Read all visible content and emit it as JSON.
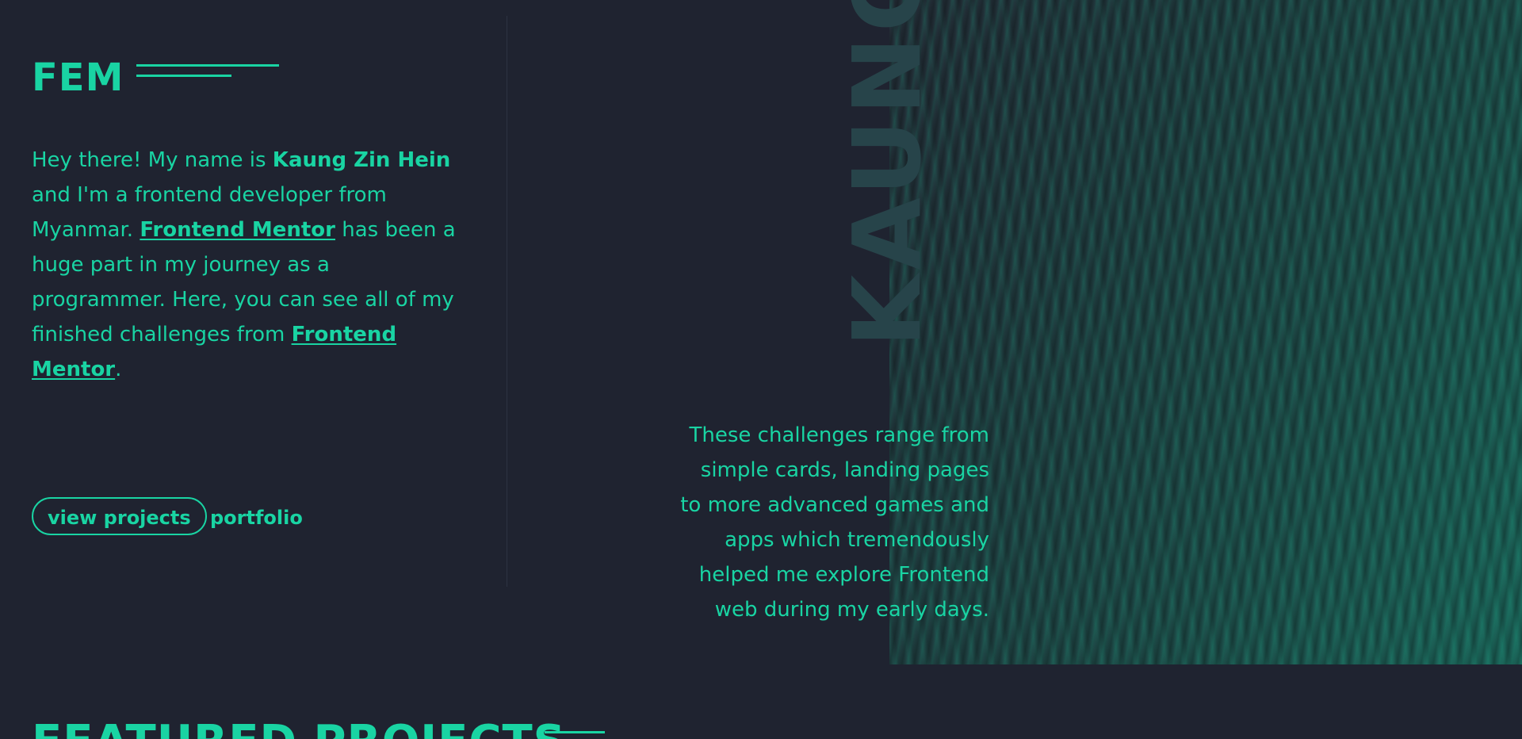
{
  "header": {
    "logo": "FEM"
  },
  "intro": {
    "part1": "Hey there! My name is ",
    "name": "Kaung Zin Hein",
    "part2": " and I'm a frontend developer from Myanmar. ",
    "link1": "Frontend Mentor",
    "part3": " has been a huge part in my journey as a programmer. Here, you can see all of my finished challenges from ",
    "link2": "Frontend Mentor",
    "part4": "."
  },
  "actions": {
    "view_projects": "view projects",
    "portfolio": "portfolio"
  },
  "hero": {
    "vertical_name": "KAUNG",
    "description": "These challenges range from simple cards, landing pages to more advanced games and apps which tremendously helped me explore Frontend web during my early days."
  },
  "featured": {
    "heading": "FEATURED PROJECTS"
  },
  "colors": {
    "background": "#1f2330",
    "accent": "#19d4a3",
    "vertical_name": "#27444a"
  }
}
